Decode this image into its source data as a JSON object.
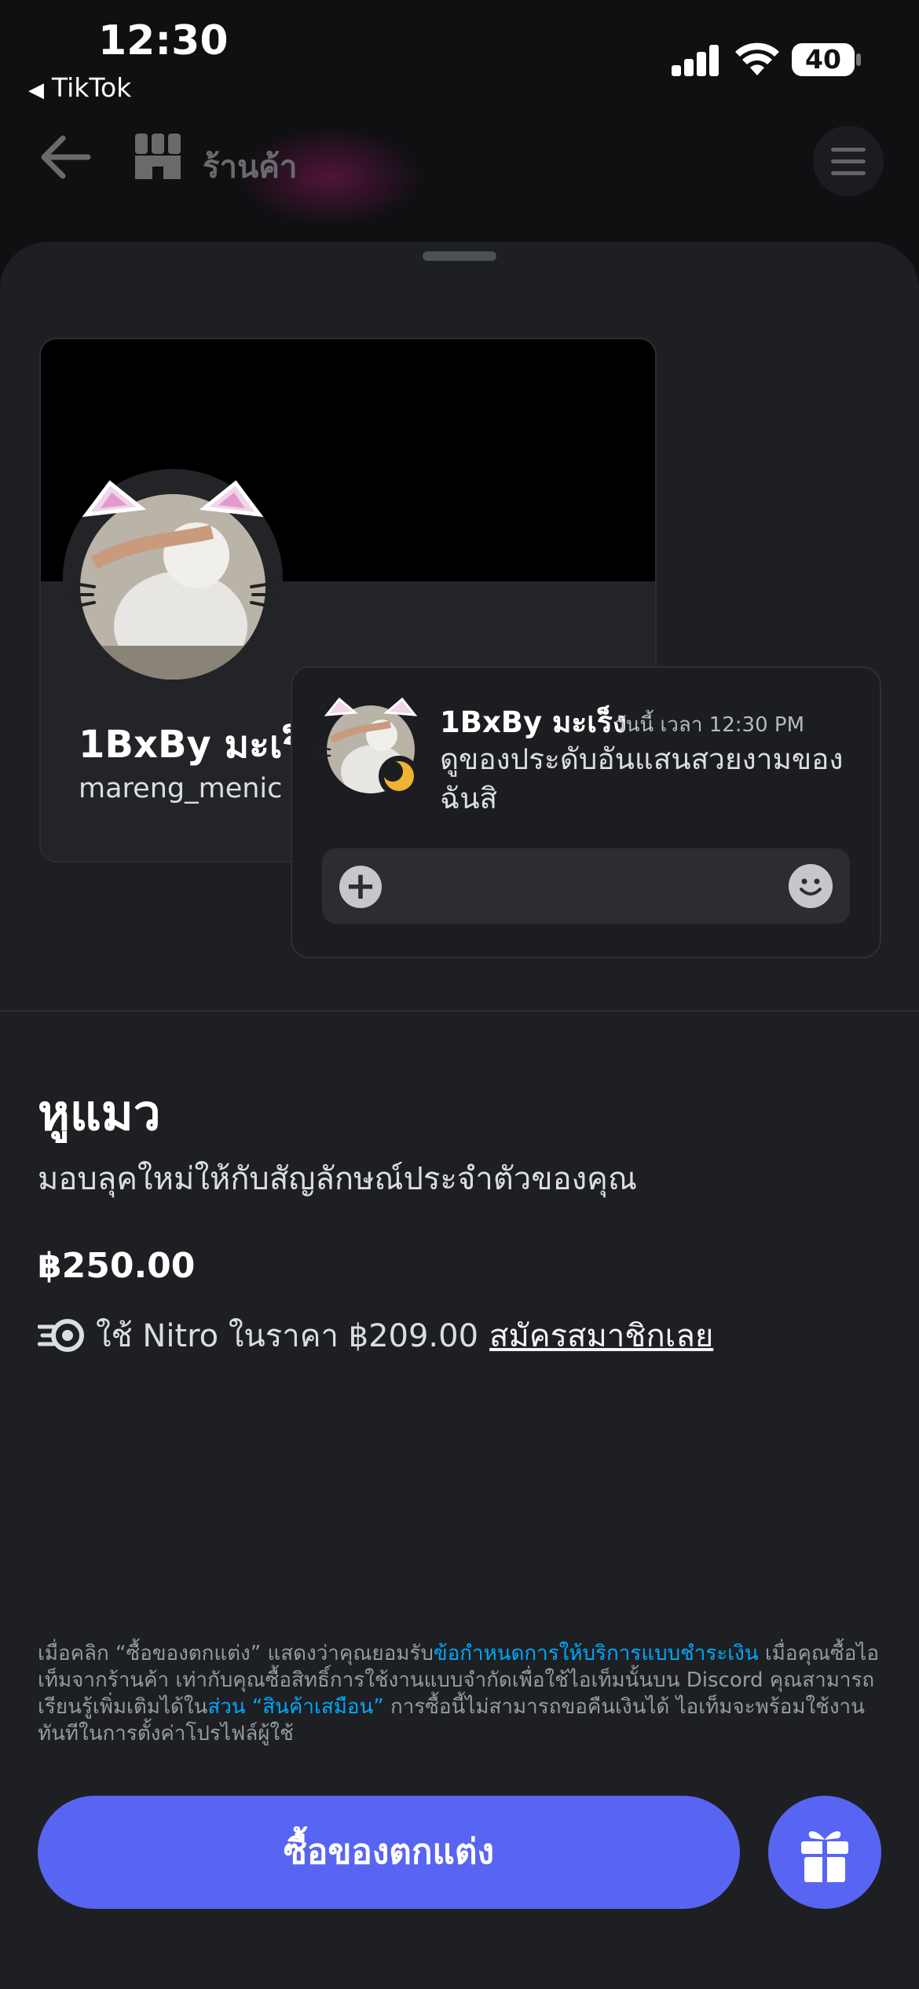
{
  "status_bar": {
    "time": "12:30",
    "back_app": "TikTok",
    "battery": "40"
  },
  "header": {
    "title": "ร้านค้า"
  },
  "preview": {
    "profile": {
      "display_name": "1BxBy มะเร็ง",
      "username": "mareng_menic"
    },
    "message": {
      "author": "1BxBy มะเร็ง",
      "timestamp": "วันนี้ เวลา 12:30 PM",
      "text": "ดูของประดับอันแสนสวยงามของฉันสิ"
    }
  },
  "product": {
    "title": "หูแมว",
    "description": "มอบลุคใหม่ให้กับสัญลักษณ์ประจำตัวของคุณ",
    "price": "฿250.00",
    "nitro_text": "ใช้ Nitro ในราคา ฿209.00",
    "subscribe_link": "สมัครสมาชิกเลย"
  },
  "legal": {
    "part1": "เมื่อคลิก “ซื้อของตกแต่ง” แสดงว่าคุณยอมรับ",
    "link1": "ข้อกำหนดการให้บริการแบบชำระเงิน",
    "part2": " เมื่อคุณซื้อไอเท็มจากร้านค้า เท่ากับคุณซื้อสิทธิ์การใช้งานแบบจำกัดเพื่อใช้ไอเท็มนั้นบน Discord คุณสามารถเรียนรู้เพิ่มเติมได้ใน",
    "link2": "ส่วน “สินค้าเสมือน”",
    "part3": " การซื้อนี้ไม่สามารถขอคืนเงินได้ ไอเท็มจะพร้อมใช้งานทันทีในการตั้งค่าโปรไฟล์ผู้ใช้"
  },
  "actions": {
    "buy_label": "ซื้อของตกแต่ง"
  },
  "colors": {
    "accent": "#5865f2",
    "sheet_bg": "#1e1f22",
    "link": "#00a8fc"
  },
  "icons": [
    "back-arrow-icon",
    "store-icon",
    "menu-icon",
    "plus-icon",
    "emoji-icon",
    "nitro-icon",
    "gift-icon",
    "moon-status-icon",
    "cat-ears-decoration-icon"
  ]
}
